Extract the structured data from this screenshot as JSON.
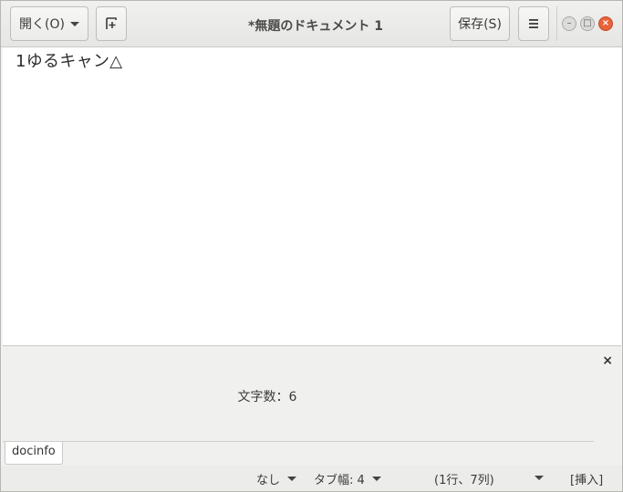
{
  "window": {
    "title": "*無題のドキュメント 1"
  },
  "header": {
    "open_button": {
      "label": "開く(O)",
      "icon": "chevron-down-icon"
    },
    "new_tab_icon": "new-document-icon",
    "save_button": {
      "label": "保存(S)"
    },
    "menu_icon": "hamburger-menu-icon",
    "window_controls": {
      "minimize": "–",
      "maximize": "□",
      "close": "×"
    }
  },
  "editor": {
    "content": "1ゆるキャン△"
  },
  "bottom_panel": {
    "close_label": "×",
    "word_count_text": "文字数：6",
    "tab_label": "docinfo"
  },
  "statusbar": {
    "language": "なし",
    "tab_width": "タブ幅: 4",
    "cursor_position": "(1行、7列)",
    "insert_mode": "[挿入]"
  },
  "colors": {
    "close_button": "#e8633a",
    "editor_bg": "#ffffff"
  }
}
